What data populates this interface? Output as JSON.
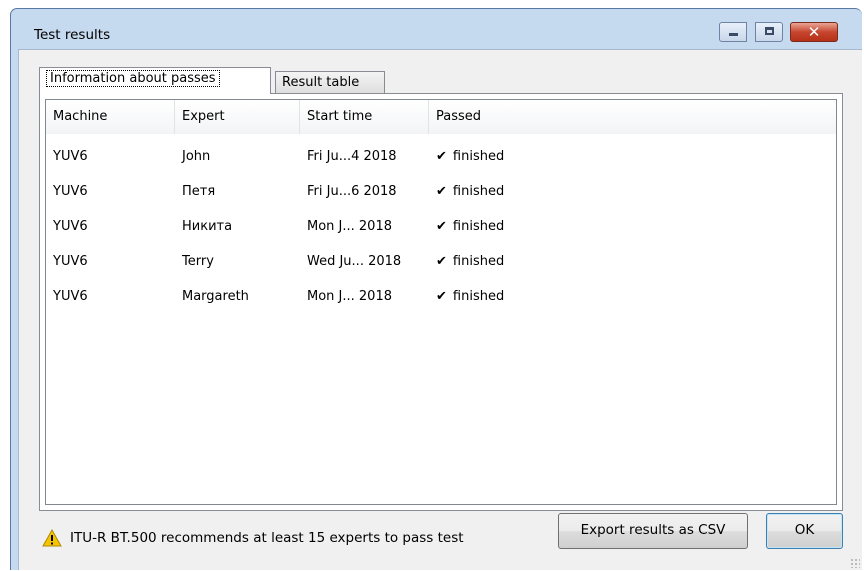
{
  "window": {
    "title": "Test results"
  },
  "tabs": [
    {
      "label": "Information about passes",
      "active": true
    },
    {
      "label": "Result table",
      "active": false
    }
  ],
  "table": {
    "columns": [
      "Machine",
      "Expert",
      "Start time",
      "Passed"
    ],
    "rows": [
      {
        "machine": "YUV6",
        "expert": "John",
        "start_time": "Fri Ju...4 2018",
        "passed": "finished"
      },
      {
        "machine": "YUV6",
        "expert": "Петя",
        "start_time": "Fri Ju...6 2018",
        "passed": "finished"
      },
      {
        "machine": "YUV6",
        "expert": "Никита",
        "start_time": "Mon J... 2018",
        "passed": "finished"
      },
      {
        "machine": "YUV6",
        "expert": "Terry",
        "start_time": "Wed Ju... 2018",
        "passed": "finished"
      },
      {
        "machine": "YUV6",
        "expert": "Margareth",
        "start_time": "Mon J... 2018",
        "passed": "finished"
      }
    ]
  },
  "footer": {
    "warning_text": "ITU-R BT.500 recommends at least 15 experts to pass test",
    "export_label": "Export results as CSV",
    "ok_label": "OK"
  },
  "icons": {
    "check": "✔",
    "warning": "warning-icon"
  },
  "colors": {
    "titlebar": "#c5d9ef",
    "close_button": "#c7462f",
    "warning": "#f5c400"
  }
}
